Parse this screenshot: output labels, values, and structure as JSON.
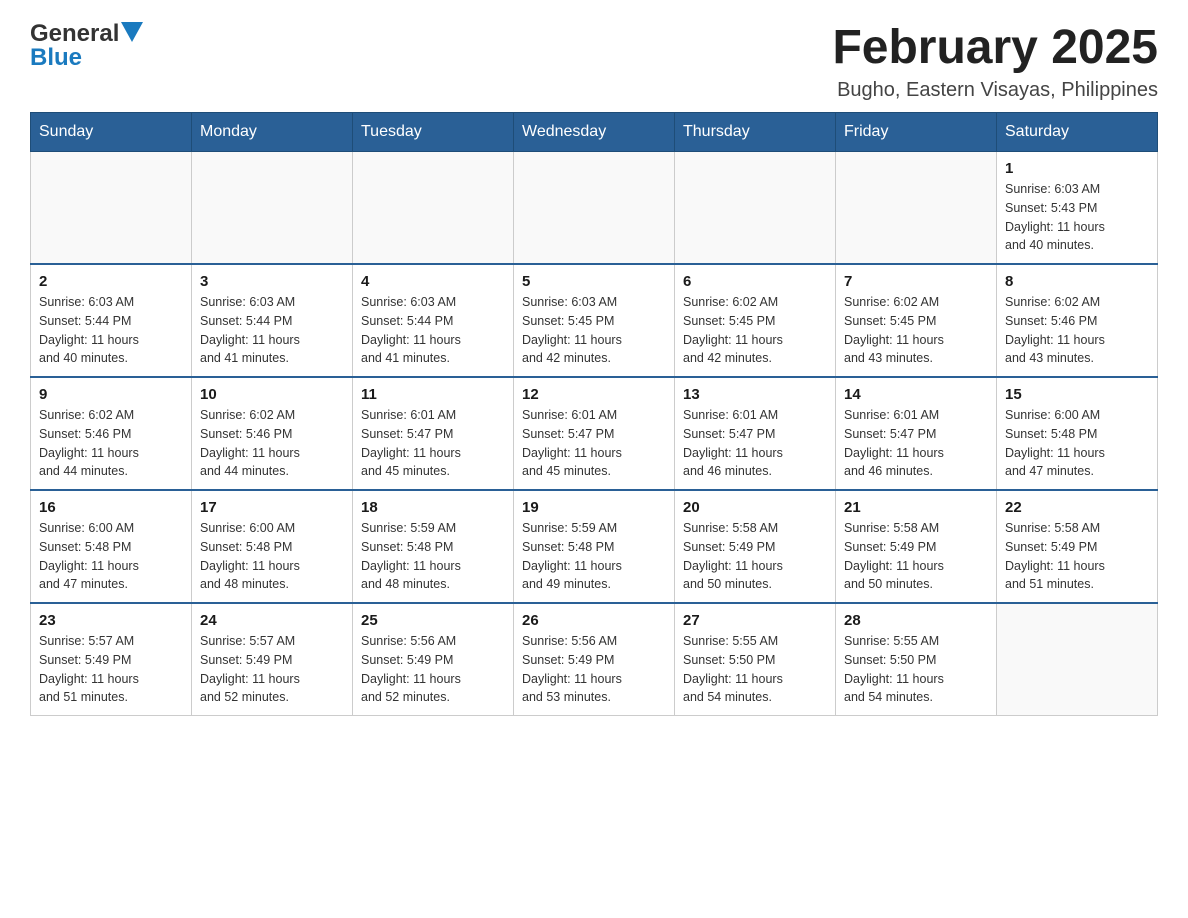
{
  "header": {
    "logo": {
      "general": "General",
      "blue": "Blue"
    },
    "title": "February 2025",
    "subtitle": "Bugho, Eastern Visayas, Philippines"
  },
  "weekdays": [
    "Sunday",
    "Monday",
    "Tuesday",
    "Wednesday",
    "Thursday",
    "Friday",
    "Saturday"
  ],
  "weeks": [
    {
      "days": [
        {
          "number": "",
          "info": ""
        },
        {
          "number": "",
          "info": ""
        },
        {
          "number": "",
          "info": ""
        },
        {
          "number": "",
          "info": ""
        },
        {
          "number": "",
          "info": ""
        },
        {
          "number": "",
          "info": ""
        },
        {
          "number": "1",
          "info": "Sunrise: 6:03 AM\nSunset: 5:43 PM\nDaylight: 11 hours\nand 40 minutes."
        }
      ]
    },
    {
      "days": [
        {
          "number": "2",
          "info": "Sunrise: 6:03 AM\nSunset: 5:44 PM\nDaylight: 11 hours\nand 40 minutes."
        },
        {
          "number": "3",
          "info": "Sunrise: 6:03 AM\nSunset: 5:44 PM\nDaylight: 11 hours\nand 41 minutes."
        },
        {
          "number": "4",
          "info": "Sunrise: 6:03 AM\nSunset: 5:44 PM\nDaylight: 11 hours\nand 41 minutes."
        },
        {
          "number": "5",
          "info": "Sunrise: 6:03 AM\nSunset: 5:45 PM\nDaylight: 11 hours\nand 42 minutes."
        },
        {
          "number": "6",
          "info": "Sunrise: 6:02 AM\nSunset: 5:45 PM\nDaylight: 11 hours\nand 42 minutes."
        },
        {
          "number": "7",
          "info": "Sunrise: 6:02 AM\nSunset: 5:45 PM\nDaylight: 11 hours\nand 43 minutes."
        },
        {
          "number": "8",
          "info": "Sunrise: 6:02 AM\nSunset: 5:46 PM\nDaylight: 11 hours\nand 43 minutes."
        }
      ]
    },
    {
      "days": [
        {
          "number": "9",
          "info": "Sunrise: 6:02 AM\nSunset: 5:46 PM\nDaylight: 11 hours\nand 44 minutes."
        },
        {
          "number": "10",
          "info": "Sunrise: 6:02 AM\nSunset: 5:46 PM\nDaylight: 11 hours\nand 44 minutes."
        },
        {
          "number": "11",
          "info": "Sunrise: 6:01 AM\nSunset: 5:47 PM\nDaylight: 11 hours\nand 45 minutes."
        },
        {
          "number": "12",
          "info": "Sunrise: 6:01 AM\nSunset: 5:47 PM\nDaylight: 11 hours\nand 45 minutes."
        },
        {
          "number": "13",
          "info": "Sunrise: 6:01 AM\nSunset: 5:47 PM\nDaylight: 11 hours\nand 46 minutes."
        },
        {
          "number": "14",
          "info": "Sunrise: 6:01 AM\nSunset: 5:47 PM\nDaylight: 11 hours\nand 46 minutes."
        },
        {
          "number": "15",
          "info": "Sunrise: 6:00 AM\nSunset: 5:48 PM\nDaylight: 11 hours\nand 47 minutes."
        }
      ]
    },
    {
      "days": [
        {
          "number": "16",
          "info": "Sunrise: 6:00 AM\nSunset: 5:48 PM\nDaylight: 11 hours\nand 47 minutes."
        },
        {
          "number": "17",
          "info": "Sunrise: 6:00 AM\nSunset: 5:48 PM\nDaylight: 11 hours\nand 48 minutes."
        },
        {
          "number": "18",
          "info": "Sunrise: 5:59 AM\nSunset: 5:48 PM\nDaylight: 11 hours\nand 48 minutes."
        },
        {
          "number": "19",
          "info": "Sunrise: 5:59 AM\nSunset: 5:48 PM\nDaylight: 11 hours\nand 49 minutes."
        },
        {
          "number": "20",
          "info": "Sunrise: 5:58 AM\nSunset: 5:49 PM\nDaylight: 11 hours\nand 50 minutes."
        },
        {
          "number": "21",
          "info": "Sunrise: 5:58 AM\nSunset: 5:49 PM\nDaylight: 11 hours\nand 50 minutes."
        },
        {
          "number": "22",
          "info": "Sunrise: 5:58 AM\nSunset: 5:49 PM\nDaylight: 11 hours\nand 51 minutes."
        }
      ]
    },
    {
      "days": [
        {
          "number": "23",
          "info": "Sunrise: 5:57 AM\nSunset: 5:49 PM\nDaylight: 11 hours\nand 51 minutes."
        },
        {
          "number": "24",
          "info": "Sunrise: 5:57 AM\nSunset: 5:49 PM\nDaylight: 11 hours\nand 52 minutes."
        },
        {
          "number": "25",
          "info": "Sunrise: 5:56 AM\nSunset: 5:49 PM\nDaylight: 11 hours\nand 52 minutes."
        },
        {
          "number": "26",
          "info": "Sunrise: 5:56 AM\nSunset: 5:49 PM\nDaylight: 11 hours\nand 53 minutes."
        },
        {
          "number": "27",
          "info": "Sunrise: 5:55 AM\nSunset: 5:50 PM\nDaylight: 11 hours\nand 54 minutes."
        },
        {
          "number": "28",
          "info": "Sunrise: 5:55 AM\nSunset: 5:50 PM\nDaylight: 11 hours\nand 54 minutes."
        },
        {
          "number": "",
          "info": ""
        }
      ]
    }
  ]
}
